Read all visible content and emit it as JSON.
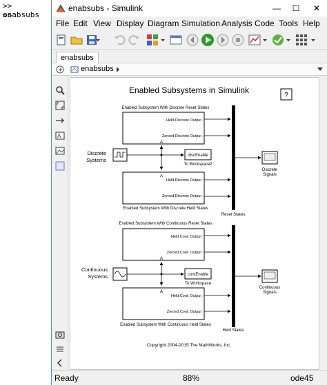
{
  "command_window": {
    "line1": ">> enabsubs",
    "line2": ">>"
  },
  "window": {
    "title": "enabsubs - Simulink",
    "minimize_glyph": "—",
    "maximize_glyph": "☐",
    "close_glyph": "✕"
  },
  "menu": {
    "file": "File",
    "edit": "Edit",
    "view": "View",
    "display": "Display",
    "diagram": "Diagram",
    "simulation": "Simulation",
    "analysis": "Analysis",
    "code": "Code",
    "tools": "Tools",
    "help": "Help"
  },
  "tab": {
    "label": "enabsubs"
  },
  "address": {
    "path": "enabsubs"
  },
  "diagram": {
    "title": "Enabled Subsystems in Simulink",
    "help_glyph": "?",
    "top_sub1_title": "Enabled Subsystem With Discrete Reset States",
    "top_sub1_out1": "Held Discrete Output",
    "top_sub1_out2": "Zeroed Discrete Output",
    "top_sub2_out1": "Held Discrete Output",
    "top_sub2_out2": "Zeroed Discrete Output",
    "top_sub2_title": "Enabled Subsystem With Discrete Held States",
    "discrete_source": "Discrete\nSystems",
    "disc_workspace": "discEnable",
    "disc_workspace_label": "To Workspace2",
    "reset_states": "Reset States",
    "discrete_scope": "Discrete\nSignals",
    "bot_sub1_title": "Enabled Subsystem With Continuous Reset States",
    "bot_sub1_out1": "Held Cont. Output",
    "bot_sub1_out2": "Zeroed Cont. Output",
    "bot_sub2_out1": "Held Cont. Output",
    "bot_sub2_out2": "Zeroed Cont. Output",
    "bot_sub2_title": "Enabled Subsystem With Continuous Held States",
    "cont_source": "Continuous\nSystems",
    "cont_workspace": "contEnable",
    "cont_workspace_label": "To Workspace",
    "held_states": "Held States",
    "cont_scope": "Continuous\nSignals",
    "copyright": "Copyright 2004-2015 The MathWorks, Inc.",
    "enable_marker": "A"
  },
  "status": {
    "ready": "Ready",
    "zoom": "88%",
    "solver": "ode45"
  },
  "colors": {
    "run_green": "#2a9a2a",
    "accent_blue": "#1e64b4"
  }
}
